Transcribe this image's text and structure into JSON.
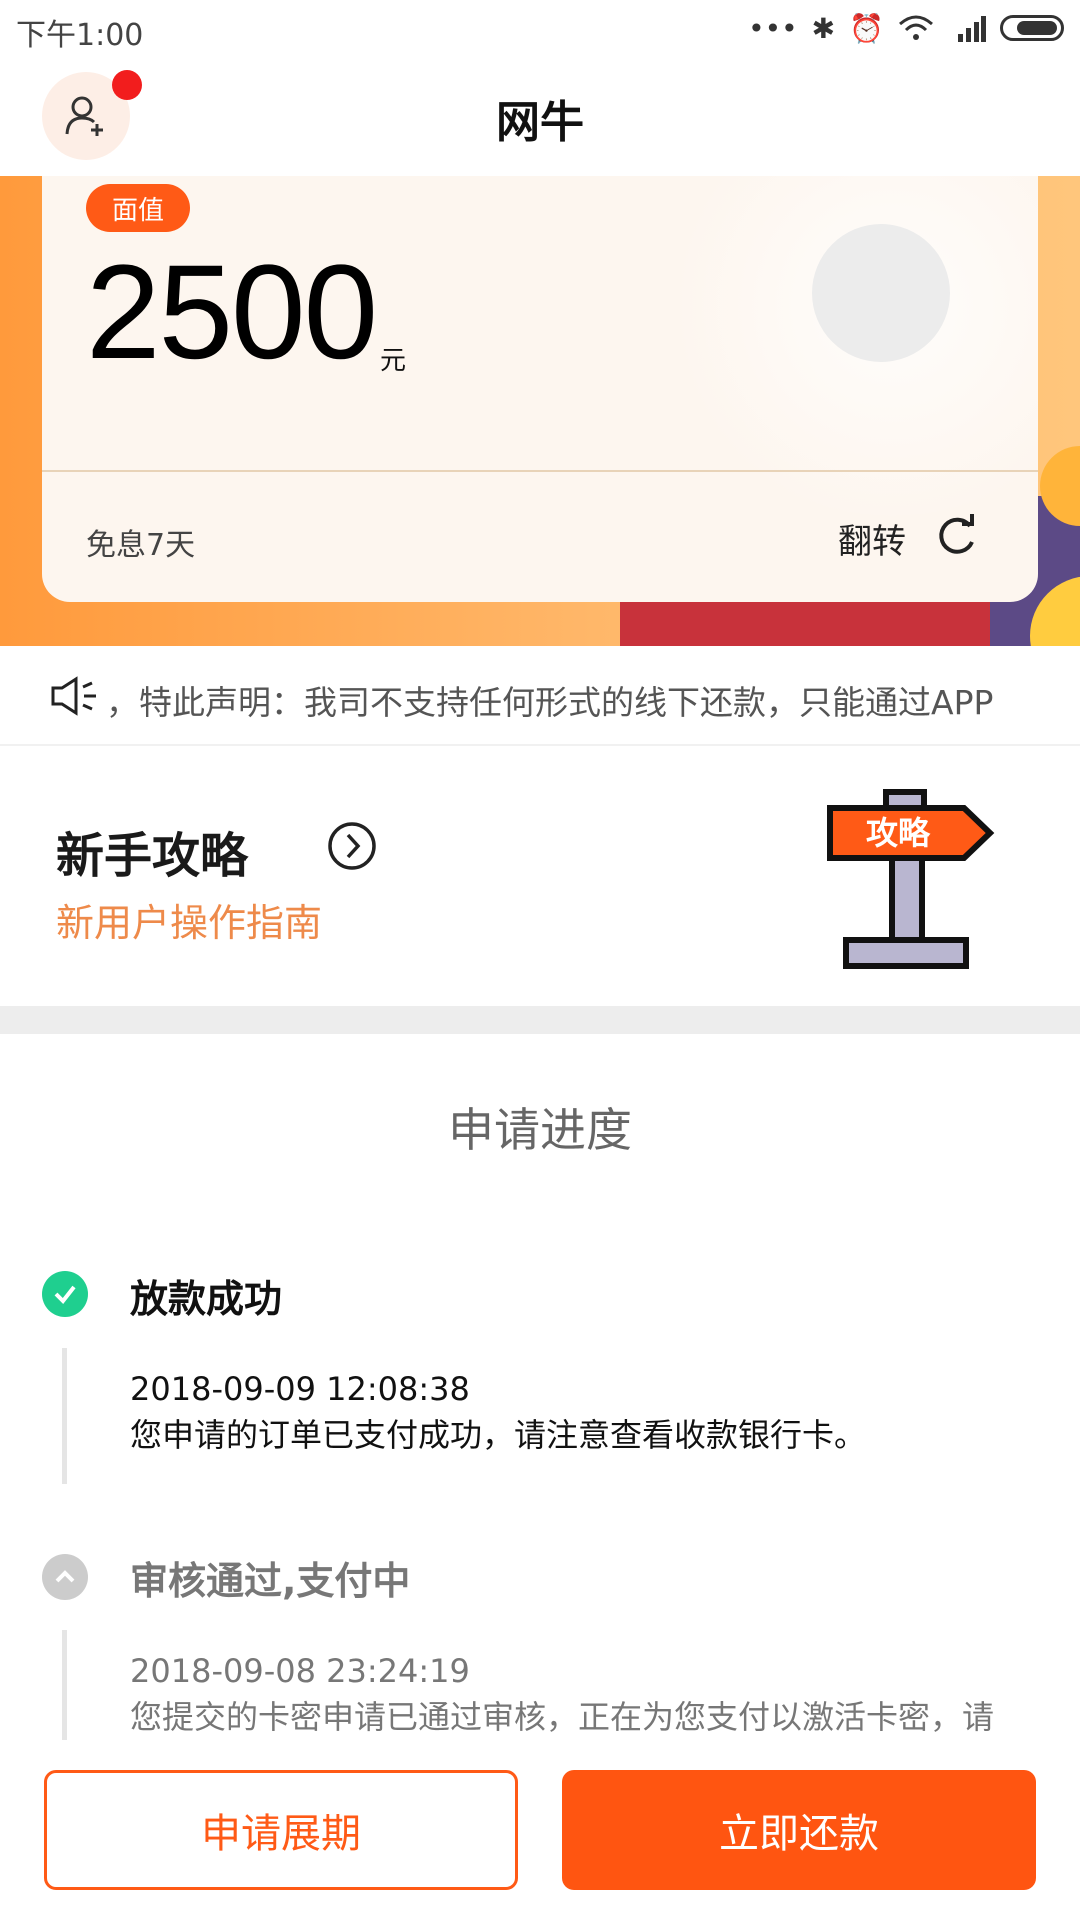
{
  "status_bar": {
    "time": "下午1:00",
    "icons": [
      "more-dots-icon",
      "bluetooth-icon",
      "alarm-icon",
      "wifi-icon",
      "hd-signal-icon",
      "battery-icon"
    ]
  },
  "header": {
    "title": "网牛",
    "avatar_icon": "add-user-icon",
    "has_notification_dot": true
  },
  "card": {
    "badge": "面值",
    "amount": "2500",
    "unit": "元",
    "interest_free": "免息7天",
    "flip_label": "翻转",
    "flip_icon": "refresh-icon"
  },
  "notice": {
    "icon": "speaker-icon",
    "text": "，特此声明：我司不支持任何形式的线下还款，只能通过APP"
  },
  "guide": {
    "title": "新手攻略",
    "subtitle": "新用户操作指南",
    "arrow_icon": "circle-chevron-right-icon",
    "signpost_text": "攻略"
  },
  "progress": {
    "title": "申请进度",
    "steps": [
      {
        "status": "done",
        "title": "放款成功",
        "time": "2018-09-09 12:08:38",
        "desc": "您申请的订单已支付成功，请注意查看收款银行卡。"
      },
      {
        "status": "pending",
        "title": "审核通过,支付中",
        "time": "2018-09-08 23:24:19",
        "desc": "您提交的卡密申请已通过审核，正在为您支付以激活卡密，请耐心等待"
      }
    ]
  },
  "actions": {
    "extend": "申请展期",
    "repay": "立即还款"
  },
  "colors": {
    "accent": "#ff5511",
    "success": "#1fcf8f",
    "guide_sub": "#ee8a4a"
  }
}
